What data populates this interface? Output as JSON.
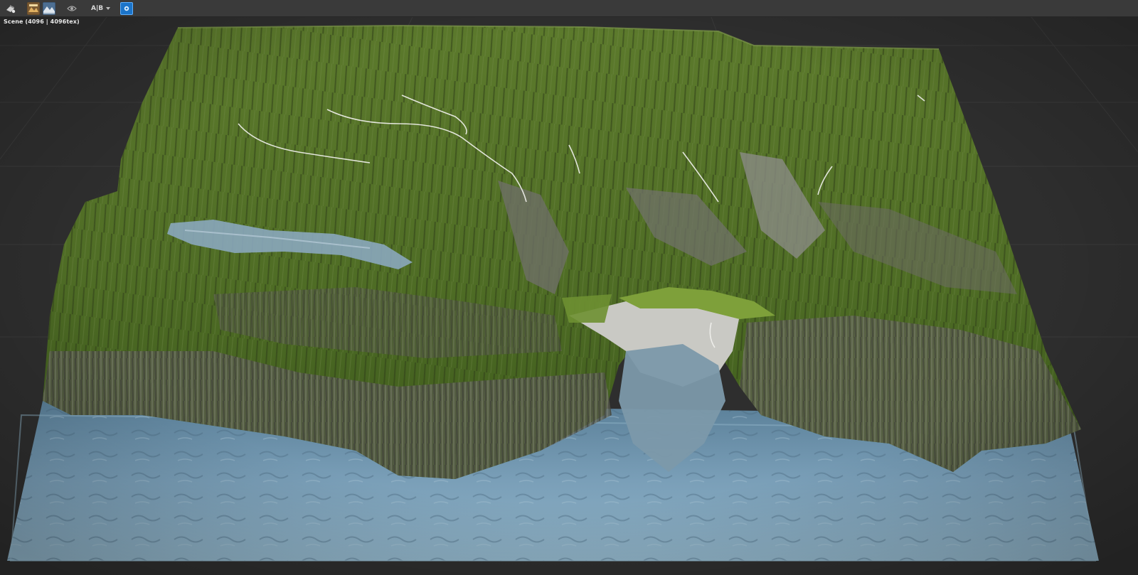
{
  "toolbar": {
    "buttons": [
      {
        "name": "camera-mode-icon"
      },
      {
        "name": "preset-thumbnail-icon"
      },
      {
        "name": "landscape-thumbnail-icon"
      },
      {
        "name": "eye-icon"
      }
    ],
    "ab_label": "A|B",
    "active_button": "viewport-toggle-icon"
  },
  "viewport": {
    "label": "Scene (4096 | 4096tex)"
  },
  "colors": {
    "toolbar_bg": "#3a3a3a",
    "viewport_bg": "#2e2e2e",
    "accent": "#1b74c9",
    "grass": "#5d7a2e",
    "rock": "#7a7a72",
    "water": "#6f94ad"
  }
}
